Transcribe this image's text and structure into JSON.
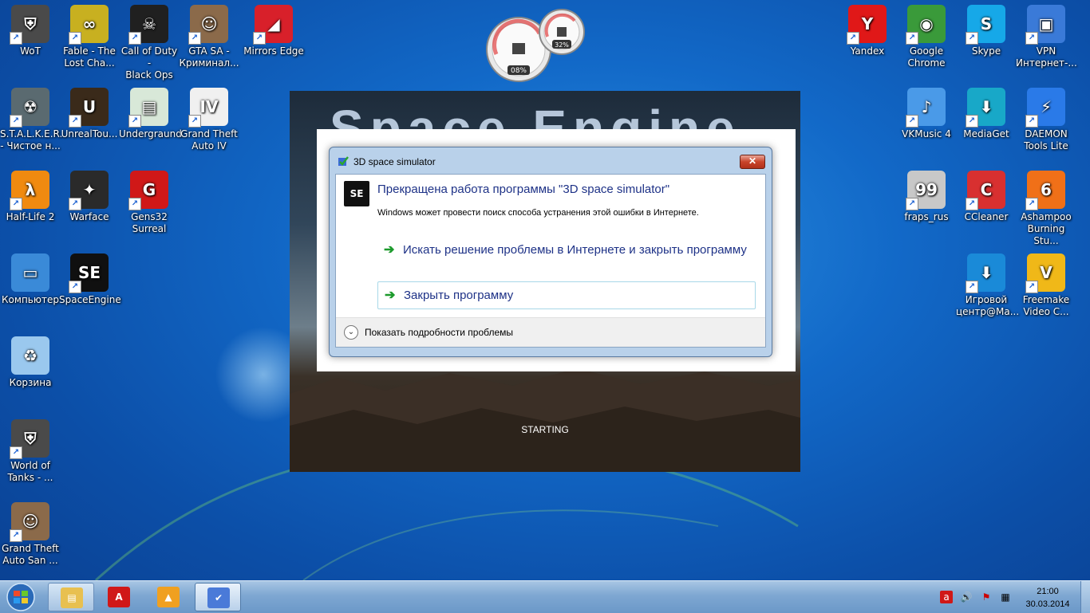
{
  "desktop": {
    "left_icons": [
      {
        "label": "WoT",
        "icon": "wot-icon",
        "color": "#4a4a4a",
        "glyph": "⛨"
      },
      {
        "label": "Fable - The\nLost Cha...",
        "icon": "fable-icon",
        "color": "#c8b020",
        "glyph": "∞"
      },
      {
        "label": "Call of Duty -\nBlack Ops",
        "icon": "cod-icon",
        "color": "#202020",
        "glyph": "☠"
      },
      {
        "label": "GTA SA -\nКриминал...",
        "icon": "gta-icon",
        "color": "#8b6a4a",
        "glyph": "☺"
      },
      {
        "label": "Mirrors Edge",
        "icon": "mirrors-edge-icon",
        "color": "#d8202a",
        "glyph": "◢"
      },
      {
        "label": "S.T.A.L.K.E.R.\n- Чистое н...",
        "icon": "stalker-icon",
        "color": "#5a6a70",
        "glyph": "☢"
      },
      {
        "label": "UnrealTou...",
        "icon": "unreal-icon",
        "color": "#3a2a1a",
        "glyph": "U"
      },
      {
        "label": "Undergraund",
        "icon": "document-icon",
        "color": "#d8e8d8",
        "glyph": "▤"
      },
      {
        "label": "Grand Theft\nAuto IV",
        "icon": "gta4-icon",
        "color": "#f0f0f0",
        "glyph": "IV"
      },
      {
        "label": "Half-Life 2",
        "icon": "halflife-icon",
        "color": "#f08a10",
        "glyph": "λ"
      },
      {
        "label": "Warface",
        "icon": "warface-icon",
        "color": "#2a2a2a",
        "glyph": "✦"
      },
      {
        "label": "Gens32\nSurreal",
        "icon": "gens-icon",
        "color": "#d01818",
        "glyph": "G"
      },
      {
        "label": "Компьютер",
        "icon": "computer-icon",
        "color": "#3a8ad8",
        "glyph": "▭"
      },
      {
        "label": "SpaceEngine",
        "icon": "spaceengine-icon",
        "color": "#101010",
        "glyph": "SE"
      },
      {
        "label": "Корзина",
        "icon": "recycle-bin-icon",
        "color": "#9ac8ee",
        "glyph": "♻"
      },
      {
        "label": "World of\nTanks - ...",
        "icon": "wot-icon",
        "color": "#4a4a4a",
        "glyph": "⛨"
      },
      {
        "label": "Grand Theft\nAuto San ...",
        "icon": "gta-icon",
        "color": "#8b6a4a",
        "glyph": "☺"
      }
    ],
    "right_icons": [
      {
        "label": "Yandex",
        "icon": "yandex-icon",
        "color": "#e01818",
        "glyph": "Y"
      },
      {
        "label": "Google\nChrome",
        "icon": "chrome-icon",
        "color": "#3a9a3a",
        "glyph": "◉"
      },
      {
        "label": "Skype",
        "icon": "skype-icon",
        "color": "#16a8e8",
        "glyph": "S"
      },
      {
        "label": "VPN\nИнтернет-...",
        "icon": "vpn-icon",
        "color": "#3a7ad8",
        "glyph": "▣"
      },
      {
        "label": "VKMusic 4",
        "icon": "vkmusic-icon",
        "color": "#4a9ae8",
        "glyph": "♪"
      },
      {
        "label": "MediaGet",
        "icon": "mediaget-icon",
        "color": "#18a8c8",
        "glyph": "⬇"
      },
      {
        "label": "DAEMON\nTools Lite",
        "icon": "daemon-icon",
        "color": "#2a7ae8",
        "glyph": "⚡"
      },
      {
        "label": "fraps_rus",
        "icon": "fraps-icon",
        "color": "#c8c8c8",
        "glyph": "99"
      },
      {
        "label": "CCleaner",
        "icon": "ccleaner-icon",
        "color": "#d83030",
        "glyph": "C"
      },
      {
        "label": "Ashampoo\nBurning Stu...",
        "icon": "ashampoo-icon",
        "color": "#f07018",
        "glyph": "6"
      },
      {
        "label": "Игровой\nцентр@Ma...",
        "icon": "game-center-icon",
        "color": "#1a8ad8",
        "glyph": "⬇"
      },
      {
        "label": "Freemake\nVideo C...",
        "icon": "freemake-icon",
        "color": "#f0b818",
        "glyph": "V"
      }
    ]
  },
  "gadget": {
    "cpu": "08%",
    "ram": "32%"
  },
  "splash": {
    "title": "Space Engine",
    "status": "STARTING"
  },
  "dialog": {
    "title": "3D space simulator",
    "close_label": "✕",
    "app_icon": "SE",
    "heading": "Прекращена работа программы \"3D space simulator\"",
    "subtext": "Windows может провести поиск способа устранения этой ошибки в Интернете.",
    "option_search": "Искать решение проблемы в Интернете и закрыть программу",
    "option_close": "Закрыть программу",
    "details": "Показать подробности проблемы"
  },
  "taskbar": {
    "buttons": [
      {
        "icon": "explorer-icon",
        "glyph": "▤",
        "color": "#e8c050"
      },
      {
        "icon": "avira-icon",
        "glyph": "A",
        "color": "#d01818"
      },
      {
        "icon": "aimp-icon",
        "glyph": "▲",
        "color": "#f0a020"
      },
      {
        "icon": "app-check-icon",
        "glyph": "✔",
        "color": "#4a7ad8"
      }
    ],
    "time": "21:00",
    "date": "30.03.2014"
  }
}
